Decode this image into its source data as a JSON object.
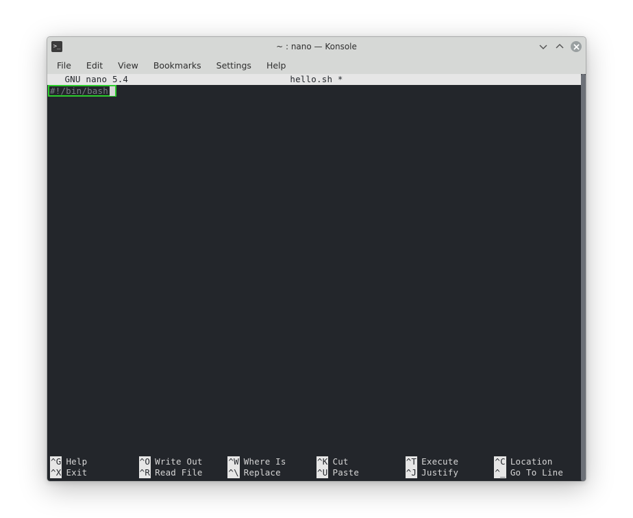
{
  "window": {
    "title": "~ : nano — Konsole"
  },
  "menubar": {
    "items": [
      "File",
      "Edit",
      "View",
      "Bookmarks",
      "Settings",
      "Help"
    ]
  },
  "nano": {
    "status_left": "  GNU nano 5.4",
    "status_center": "hello.sh *",
    "content_line": "#!/bin/bash"
  },
  "shortcuts": {
    "row1": [
      {
        "key": "^G",
        "label": "Help"
      },
      {
        "key": "^O",
        "label": "Write Out"
      },
      {
        "key": "^W",
        "label": "Where Is"
      },
      {
        "key": "^K",
        "label": "Cut"
      },
      {
        "key": "^T",
        "label": "Execute"
      },
      {
        "key": "^C",
        "label": "Location"
      }
    ],
    "row2": [
      {
        "key": "^X",
        "label": "Exit"
      },
      {
        "key": "^R",
        "label": "Read File"
      },
      {
        "key": "^\\",
        "label": "Replace"
      },
      {
        "key": "^U",
        "label": "Paste"
      },
      {
        "key": "^J",
        "label": "Justify"
      },
      {
        "key": "^_",
        "label": "Go To Line"
      }
    ]
  }
}
